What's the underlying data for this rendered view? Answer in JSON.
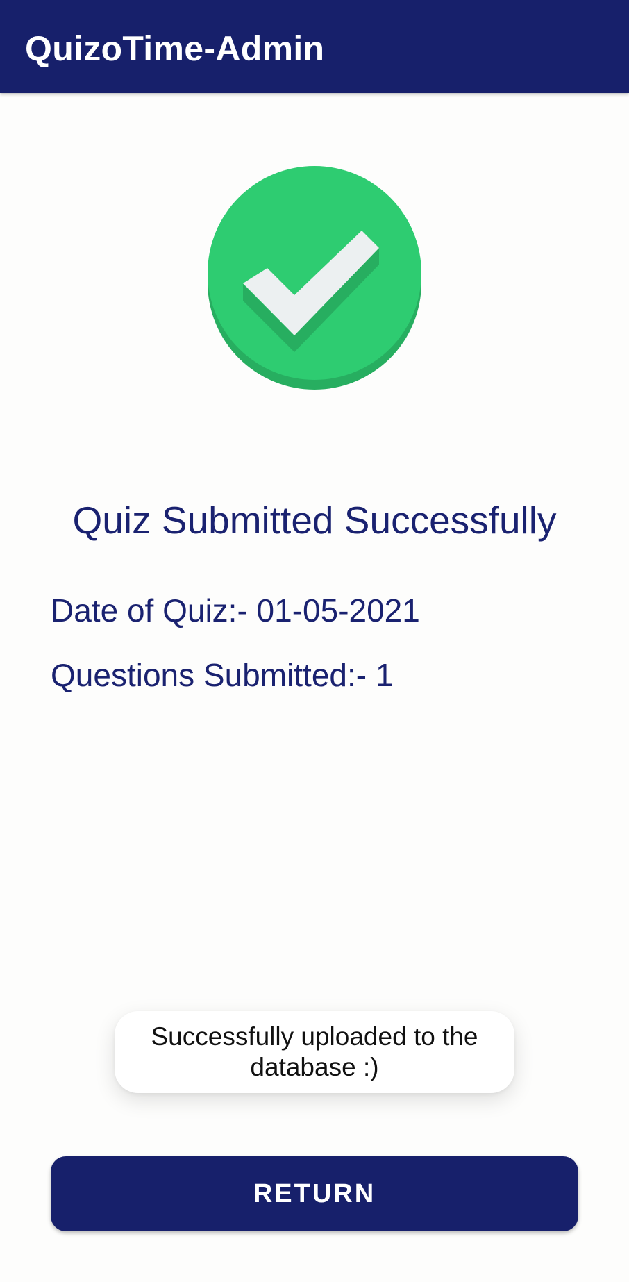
{
  "app_bar": {
    "title": "QuizoTime-Admin",
    "color": "#17206b"
  },
  "success_icon": {
    "name": "check-circle-icon",
    "circle_color": "#2ecc71",
    "shadow_color": "#27ae60",
    "check_color": "#ecf0f1"
  },
  "main": {
    "heading": "Quiz Submitted Successfully",
    "date_line": "Date of Quiz:- 01-05-2021",
    "questions_line": "Questions Submitted:- 1",
    "text_color": "#1a2270"
  },
  "toast": {
    "message": "Successfully uploaded to the database :)"
  },
  "return_button": {
    "label": "RETURN"
  }
}
